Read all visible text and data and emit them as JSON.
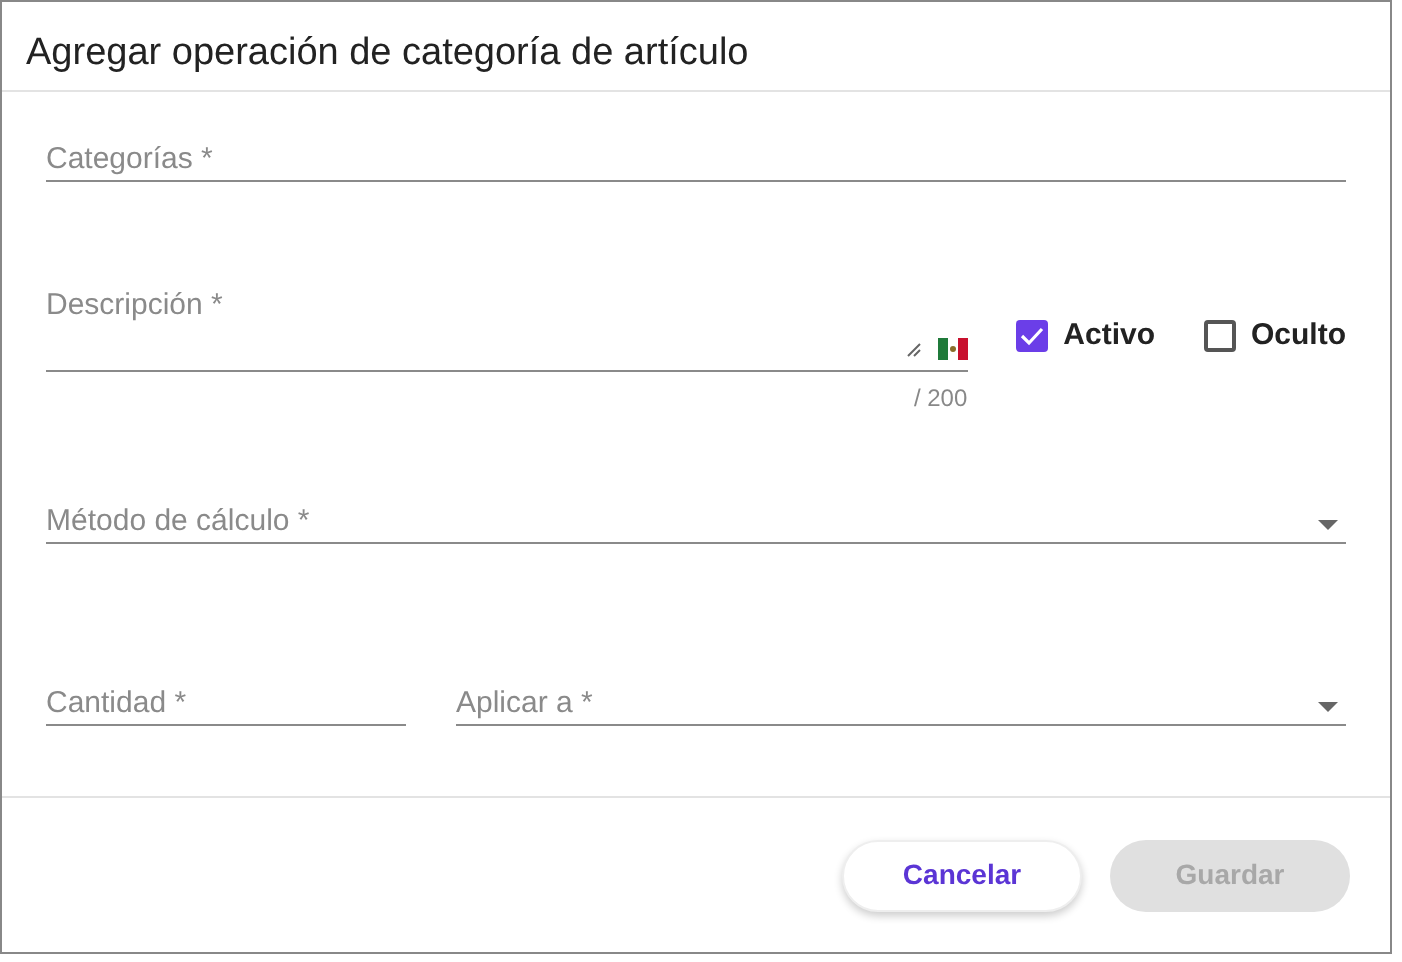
{
  "dialog": {
    "title": "Agregar operación de categoría de artículo"
  },
  "categories_field": {
    "placeholder": "Categorías *"
  },
  "description_field": {
    "placeholder": "Descripción *",
    "counter": "/ 200"
  },
  "checkboxes": [
    {
      "label": "Activo",
      "checked": true
    },
    {
      "label": "Oculto",
      "checked": false
    }
  ],
  "method_select": {
    "placeholder": "Método de cálculo *"
  },
  "quantity_field": {
    "placeholder": "Cantidad *"
  },
  "apply_select": {
    "placeholder": "Aplicar a *"
  },
  "buttons": [
    {
      "label": "Cancelar",
      "disabled": false
    },
    {
      "label": "Guardar",
      "disabled": true
    }
  ]
}
